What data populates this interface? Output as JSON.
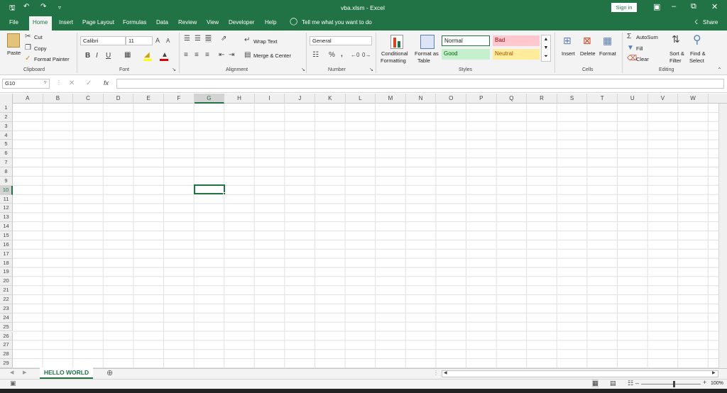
{
  "title": "vba.xlsm  -  Excel",
  "signin": "Sign in",
  "share": "Share",
  "tabs": [
    "File",
    "Home",
    "Insert",
    "Page Layout",
    "Formulas",
    "Data",
    "Review",
    "View",
    "Developer",
    "Help"
  ],
  "tell_me": "Tell me what you want to do",
  "clipboard": {
    "paste": "Paste",
    "cut": "Cut",
    "copy": "Copy",
    "format_painter": "Format Painter",
    "group": "Clipboard"
  },
  "font": {
    "name": "Calibri",
    "size": "11",
    "bold": "B",
    "italic": "I",
    "underline": "U",
    "grow": "A",
    "shrink": "A",
    "group": "Font"
  },
  "alignment": {
    "wrap": "Wrap Text",
    "merge": "Merge & Center",
    "group": "Alignment"
  },
  "number": {
    "format": "General",
    "percent": "%",
    "comma": ",",
    "group": "Number"
  },
  "styles": {
    "conditional": "Conditional",
    "conditional2": "Formatting",
    "format_as": "Format as",
    "format_as2": "Table",
    "normal": "Normal",
    "bad": "Bad",
    "good": "Good",
    "neutral": "Neutral",
    "group": "Styles",
    "colors": {
      "normal": "#ffffff",
      "bad": "#ffc7ce",
      "good": "#c6efce",
      "neutral": "#ffeb9c",
      "bad_text": "#9c0006",
      "good_text": "#006100",
      "neutral_text": "#9c5700"
    }
  },
  "cells": {
    "insert": "Insert",
    "delete": "Delete",
    "format": "Format",
    "group": "Cells"
  },
  "editing": {
    "autosum": "AutoSum",
    "fill": "Fill",
    "clear": "Clear",
    "sort": "Sort &",
    "sort2": "Filter",
    "find": "Find &",
    "find2": "Select",
    "group": "Editing"
  },
  "name_box": "G10",
  "fx": "fx",
  "columns": [
    "A",
    "B",
    "C",
    "D",
    "E",
    "F",
    "G",
    "H",
    "I",
    "J",
    "K",
    "L",
    "M",
    "N",
    "O",
    "P",
    "Q",
    "R",
    "S",
    "T",
    "U",
    "V",
    "W"
  ],
  "rows": [
    "1",
    "2",
    "3",
    "4",
    "5",
    "6",
    "7",
    "8",
    "9",
    "10",
    "11",
    "12",
    "13",
    "14",
    "15",
    "16",
    "17",
    "18",
    "19",
    "20",
    "21",
    "22",
    "23",
    "24",
    "25",
    "26",
    "27",
    "28",
    "29"
  ],
  "selected_col": "G",
  "selected_row": "10",
  "sheet_name": "HELLO WORLD",
  "zoom": "100%",
  "accent": "#217346"
}
